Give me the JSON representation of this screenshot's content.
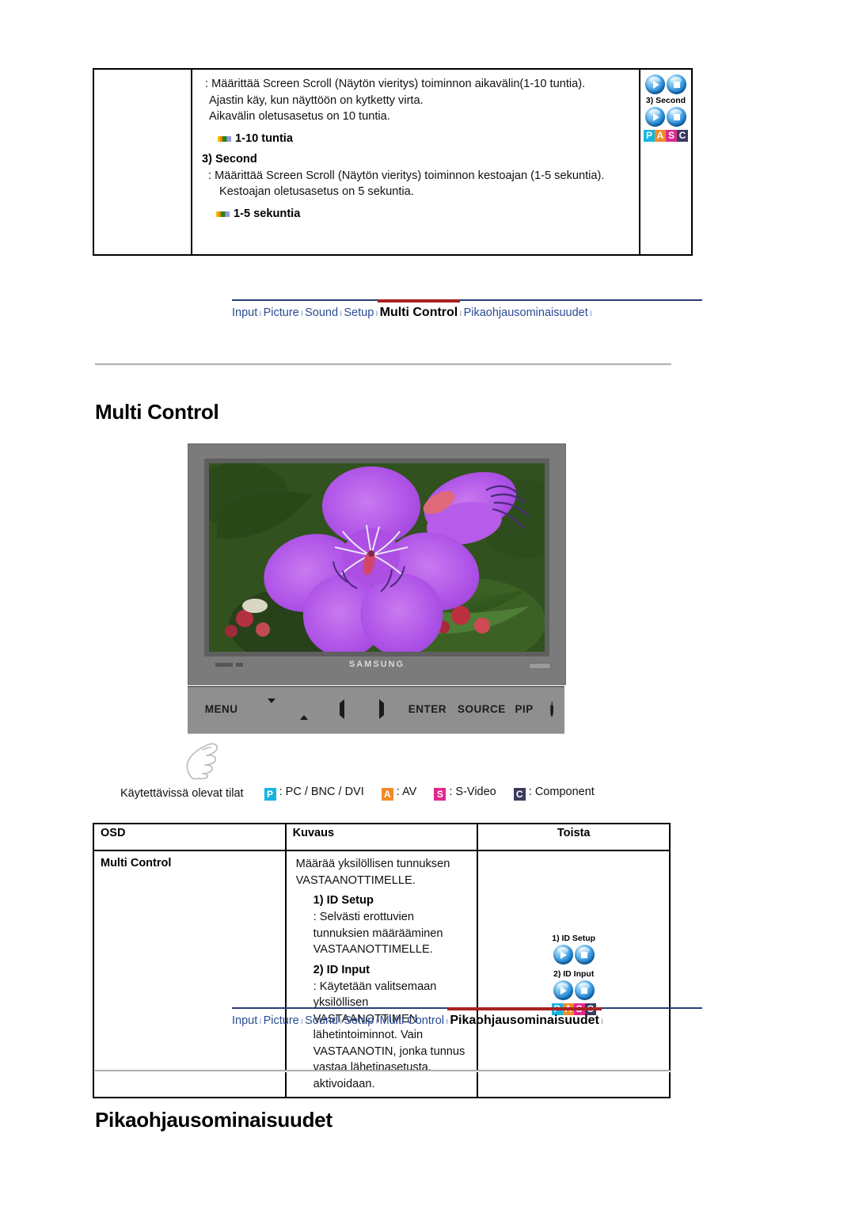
{
  "top_table": {
    "columns": [
      "",
      "",
      ""
    ],
    "row": {
      "osd": "",
      "description": {
        "line1": ": Määrittää Screen Scroll (Näytön vieritys) toiminnon aikavälin(1-10 tuntia).",
        "line2": "Ajastin käy, kun näyttöön on kytketty virta.",
        "line3": "Aikavälin oletusasetus on 10 tuntia.",
        "bullet1": "1-10 tuntia",
        "heading2": "3) Second",
        "line4": ": Määrittää Screen Scroll (Näytön vieritys) toiminnon kestoajan (1-5 sekuntia).",
        "line5": "Kestoajan oletusasetus on 5 sekuntia.",
        "bullet2": "1-5 sekuntia"
      },
      "repeat": {
        "caption": "3) Second",
        "pasc": [
          "P",
          "A",
          "S",
          "C"
        ]
      }
    }
  },
  "nav_top": {
    "items": [
      {
        "label": "Input",
        "active": false
      },
      {
        "label": "Picture",
        "active": false
      },
      {
        "label": "Sound",
        "active": false
      },
      {
        "label": "Setup",
        "active": false
      },
      {
        "label": "Multi Control",
        "active": true
      },
      {
        "label": "Pikaohjausominaisuudet",
        "active": false
      }
    ],
    "separator": "ı",
    "active_color": "#a82222",
    "link_color": "#2a4b93"
  },
  "nav_bottom": {
    "items": [
      {
        "label": "Input",
        "active": false
      },
      {
        "label": "Picture",
        "active": false
      },
      {
        "label": "Sound",
        "active": false
      },
      {
        "label": "Setup",
        "active": false
      },
      {
        "label": "Multi Control",
        "active": false
      },
      {
        "label": "Pikaohjausominaisuudet",
        "active": true
      }
    ],
    "separator": "ı",
    "active_color": "#a82222",
    "link_color": "#2a4b93"
  },
  "section_multi_control": {
    "heading": "Multi Control"
  },
  "section_quick": {
    "heading": "Pikaohjausominaisuudet"
  },
  "monitor": {
    "brand": "SAMSUNG",
    "keys": [
      "MENU",
      "▼",
      "▲",
      "◄",
      "►",
      "ENTER",
      "SOURCE",
      "PIP",
      "power"
    ],
    "key_labels": {
      "menu": "MENU",
      "enter": "ENTER",
      "source": "SOURCE",
      "pip": "PIP"
    }
  },
  "legend": {
    "label": "Käytettävissä olevat tilat",
    "items": [
      {
        "chip": "P",
        "text": ": PC / BNC / DVI",
        "color": "#16b5e0"
      },
      {
        "chip": "A",
        "text": ": AV",
        "color": "#f08a2a"
      },
      {
        "chip": "S",
        "text": ": S-Video",
        "color": "#e0288c"
      },
      {
        "chip": "C",
        "text": ": Component",
        "color": "#3b3b5e"
      }
    ]
  },
  "bottom_table": {
    "headers": [
      "OSD",
      "Kuvaus",
      "Toista"
    ],
    "row": {
      "osd": "Multi Control",
      "description": {
        "line1": "Määrää yksilöllisen tunnuksen VASTAANOTTIMELLE.",
        "heading1": "1) ID Setup",
        "line2": ": Selvästi erottuvien tunnuksien määrääminen VASTAANOTTIMELLE.",
        "heading2": "2) ID Input",
        "line3": ": Käytetään valitsemaan yksilöllisen VASTAANOTTIMEN lähetintoiminnot. Vain VASTAANOTIN, jonka tunnus vastaa lähetinasetusta, aktivoidaan."
      },
      "repeat": {
        "caption1": "1) ID Setup",
        "caption2": "2) ID Input",
        "pasc": [
          "P",
          "A",
          "S",
          "C"
        ]
      }
    }
  }
}
